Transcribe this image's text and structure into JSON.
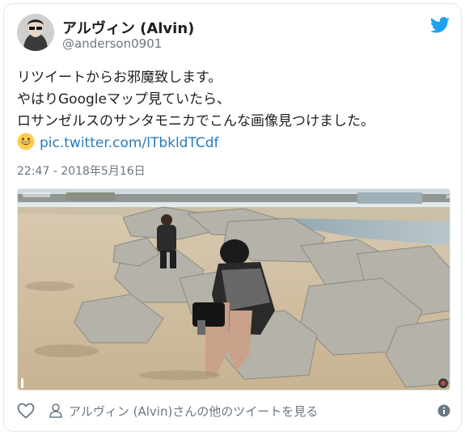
{
  "tweet": {
    "display_name": "アルヴィン (Alvin)",
    "handle": "@anderson0901",
    "text_lines": [
      "リツイートからお邪魔致します。",
      "やはりGoogleマップ見ていたら、",
      "ロサンゼルスのサンタモニカでこんな画像見つけました。"
    ],
    "emoji": "grinning-face-icon",
    "link_text": "pic.twitter.com/lTbkldTCdf",
    "timestamp": "22:47 - 2018年5月16日"
  },
  "footer": {
    "more_tweets_label": "アルヴィン (Alvin)さんの他のツイートを見る"
  },
  "colors": {
    "link": "#2b7bb9",
    "twitter_blue": "#1da1f2",
    "muted": "#697882",
    "border": "#e1e8ed"
  },
  "icons": {
    "brand": "twitter-bird-icon",
    "like": "heart-icon",
    "profile": "person-icon",
    "info": "info-icon"
  }
}
